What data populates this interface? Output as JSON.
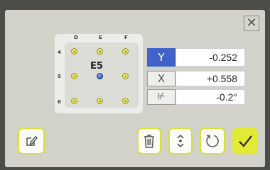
{
  "dialog": {
    "close_icon": "close-icon",
    "close_glyph": "✕"
  },
  "grid": {
    "title": "E5",
    "columns": [
      "D",
      "E",
      "F"
    ],
    "rows": [
      "4",
      "5",
      "6"
    ],
    "selected": "E5",
    "colors": {
      "dot": "#e2e25a",
      "selected": "#2a50b6"
    }
  },
  "values": {
    "y": {
      "label": "Y",
      "value": "-0.252"
    },
    "x": {
      "label": "X",
      "value": "+0.558"
    },
    "angle": {
      "label": "⊬",
      "value": "-0.2°"
    }
  },
  "buttons": {
    "edit": "edit-icon",
    "delete": "trash-icon",
    "adjust": "up-down-icon",
    "reset": "refresh-icon",
    "confirm": "check-icon"
  },
  "colors": {
    "accent": "#e1ea35",
    "active_field": "#3f63c8"
  }
}
